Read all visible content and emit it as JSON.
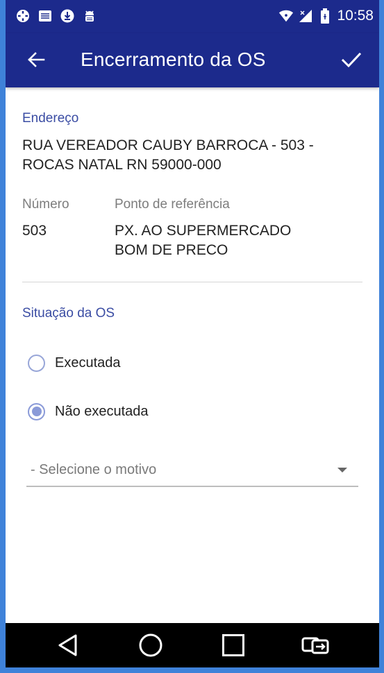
{
  "status_bar": {
    "time": "10:58",
    "left_icons": [
      "location-crosshair-icon",
      "list-icon",
      "download-icon",
      "android-debug-icon"
    ],
    "right_icons": [
      "wifi-icon",
      "signal-icon",
      "battery-icon"
    ]
  },
  "app_bar": {
    "title": "Encerramento da OS",
    "back_icon": "arrow-back-icon",
    "confirm_icon": "check-icon",
    "background": "#1c2a8c"
  },
  "address": {
    "label": "Endereço",
    "line1": "RUA VEREADOR CAUBY BARROCA - 503 -",
    "line2": "ROCAS NATAL RN 59000-000"
  },
  "number": {
    "label": "Número",
    "value": "503"
  },
  "reference": {
    "label": "Ponto de referência",
    "line1": "PX. AO SUPERMERCADO",
    "line2": "BOM DE PRECO"
  },
  "situation": {
    "label": "Situação da OS",
    "options": [
      {
        "label": "Executada",
        "checked": false
      },
      {
        "label": "Não executada",
        "checked": true
      }
    ]
  },
  "reason_select": {
    "selected": "- Selecione o motivo"
  },
  "nav_bar": {
    "buttons": [
      "back-triangle-icon",
      "home-circle-icon",
      "recents-square-icon",
      "rotate-screen-icon"
    ]
  },
  "colors": {
    "accent": "#3a4ca3",
    "radio": "#8a9ad8",
    "frame": "#3f82d9"
  }
}
